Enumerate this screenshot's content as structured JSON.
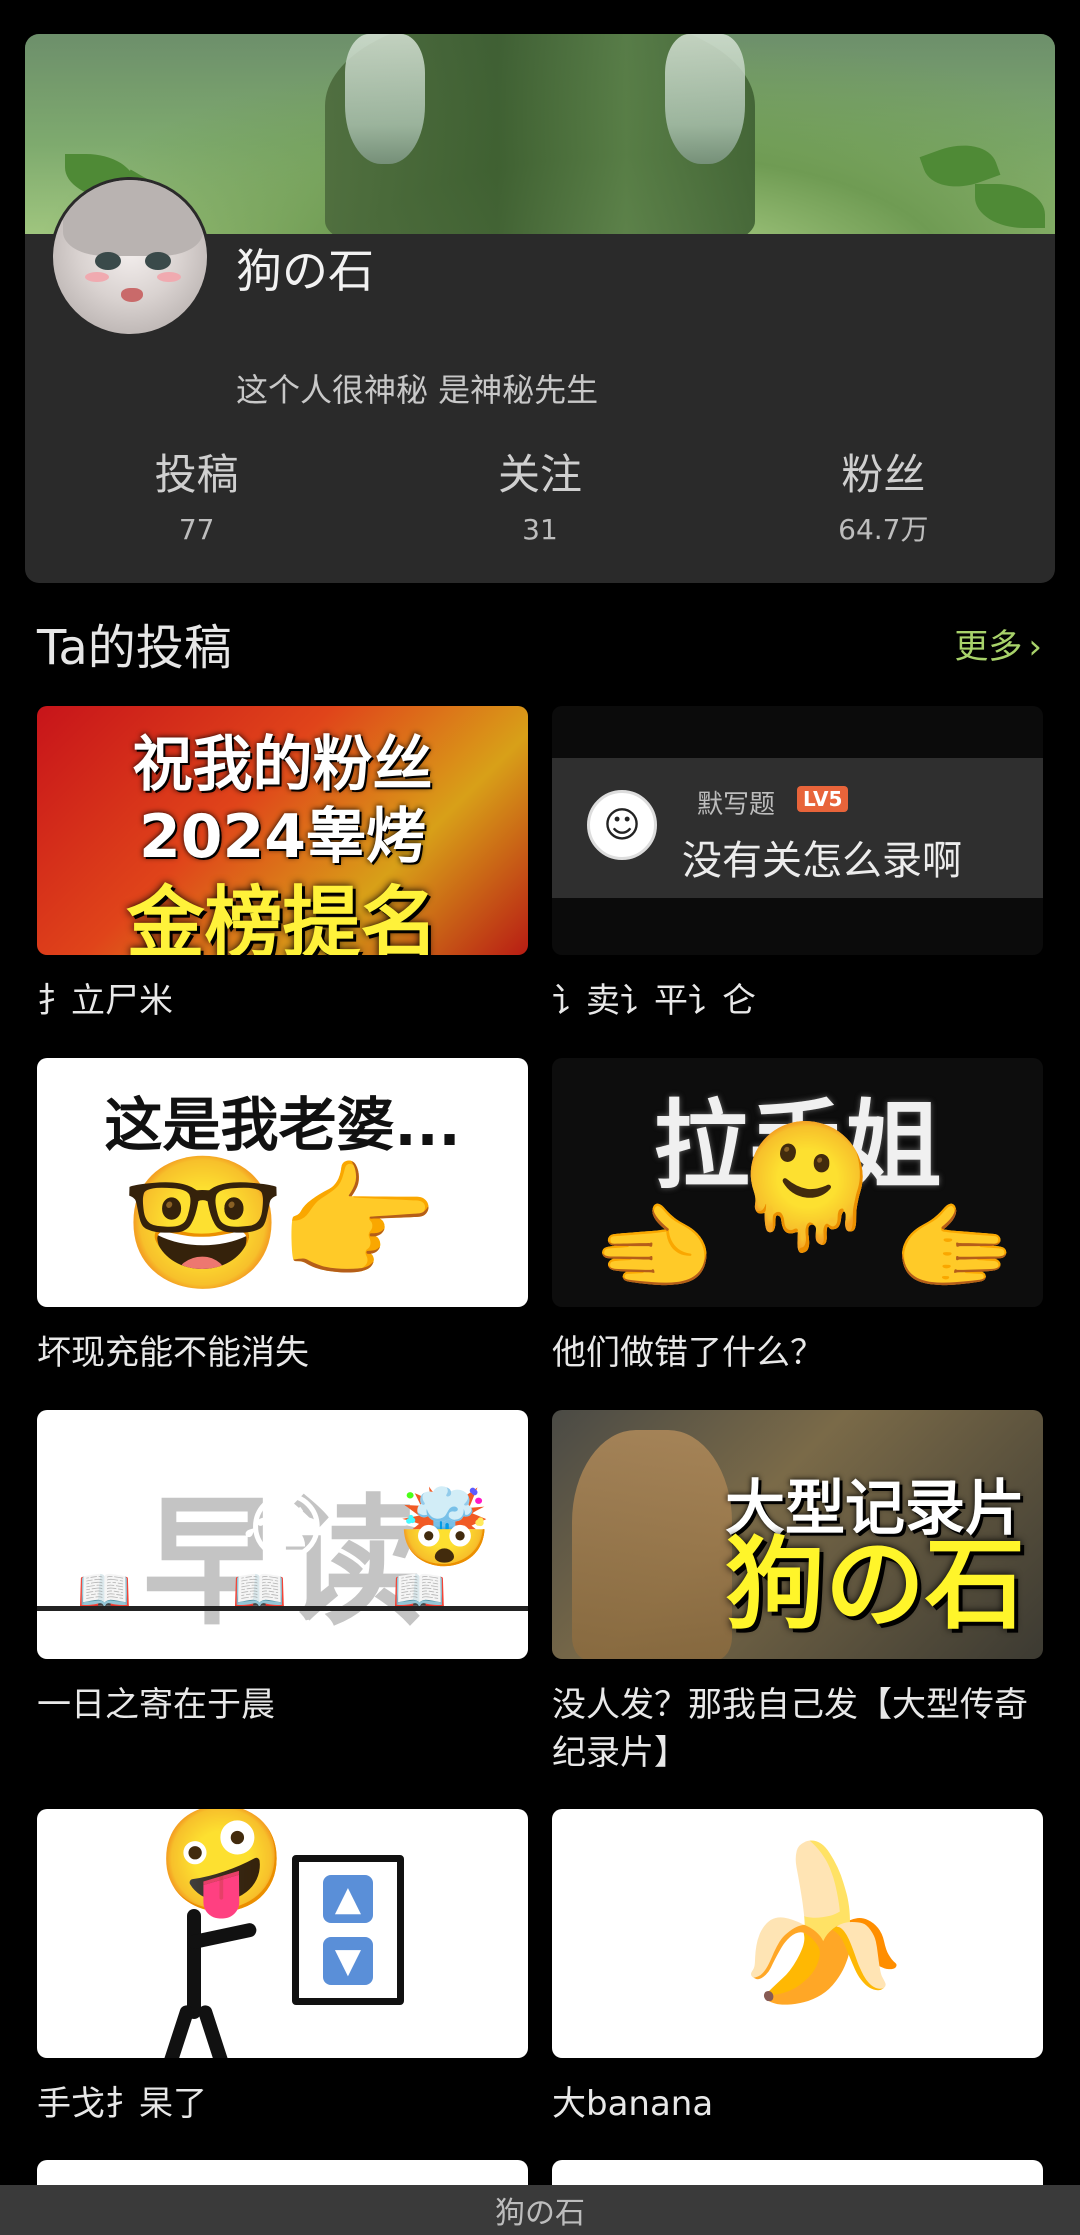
{
  "profile": {
    "username": "狗の石",
    "bio": "这个人很神秘 是神秘先生",
    "stats": [
      {
        "label": "投稿",
        "value": "77"
      },
      {
        "label": "关注",
        "value": "31"
      },
      {
        "label": "粉丝",
        "value": "64.7万"
      }
    ]
  },
  "section": {
    "title": "Ta的投稿",
    "more_label": "更多"
  },
  "videos": [
    {
      "title": "扌立尸米",
      "thumb_text": [
        "祝我的粉丝",
        "2024睾烤",
        "金榜提名"
      ]
    },
    {
      "title": "讠卖讠平讠仑",
      "thumb_comment_user": "默写题",
      "thumb_comment_level": "LV5",
      "thumb_comment": "没有关怎么录啊"
    },
    {
      "title": "坏现充能不能消失",
      "thumb_text": "这是我老婆..."
    },
    {
      "title": "他们做错了什么？",
      "thumb_text": "拉手姐"
    },
    {
      "title": "一日之寄在于晨",
      "thumb_text": "早读"
    },
    {
      "title": "没人发？那我自己发【大型传奇纪录片】",
      "thumb_text": [
        "大型记录片",
        "狗の石"
      ]
    },
    {
      "title": "手戈扌杲了"
    },
    {
      "title": "大banana"
    }
  ],
  "bottom_bar": {
    "title": "狗の石"
  },
  "colors": {
    "accent": "#a8d26a",
    "card_bg": "#2a2a2a",
    "page_bg": "#000000"
  }
}
